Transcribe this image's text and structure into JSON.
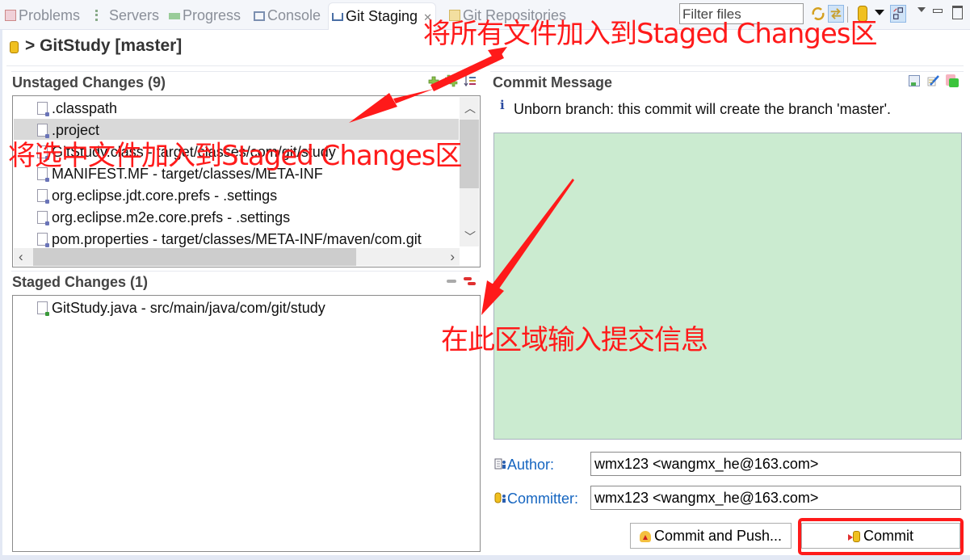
{
  "tabs": [
    {
      "label": "Problems",
      "icon": "problems-icon",
      "active": false
    },
    {
      "label": "Servers",
      "icon": "servers-icon",
      "active": false
    },
    {
      "label": "Progress",
      "icon": "progress-icon",
      "active": false
    },
    {
      "label": "Console",
      "icon": "console-icon",
      "active": false
    },
    {
      "label": "Git Staging",
      "icon": "git-staging-icon",
      "active": true,
      "close_icon": "close-icon"
    },
    {
      "label": "Git Repositories",
      "icon": "git-repositories-icon",
      "active": false
    }
  ],
  "toolbar": {
    "filter_placeholder": "Filter files",
    "icons": [
      "refresh-icon",
      "link-with-selection-icon",
      "repository-icon",
      "dropdown-arrow-icon",
      "presentation-mode-icon",
      "view-menu-icon",
      "minimize-icon",
      "maximize-icon"
    ]
  },
  "repo": {
    "title": "> GitStudy [master]"
  },
  "unstaged": {
    "title": "Unstaged Changes (9)",
    "actions": [
      "add-to-index-icon",
      "add-all-to-index-icon",
      "sort-icon"
    ],
    "items": [
      {
        "label": ".classpath",
        "selected": false
      },
      {
        "label": ".project",
        "selected": true
      },
      {
        "label": "GitStudy.class - target/classes/com/git/study",
        "selected": false
      },
      {
        "label": "MANIFEST.MF - target/classes/META-INF",
        "selected": false
      },
      {
        "label": "org.eclipse.jdt.core.prefs - .settings",
        "selected": false
      },
      {
        "label": "org.eclipse.m2e.core.prefs - .settings",
        "selected": false
      },
      {
        "label": "pom.properties - target/classes/META-INF/maven/com.git",
        "selected": false
      }
    ]
  },
  "staged": {
    "title": "Staged Changes (1)",
    "actions": [
      "collapse-icon",
      "remove-from-index-icon"
    ],
    "items": [
      {
        "label": "GitStudy.java - src/main/java/com/git/study"
      }
    ]
  },
  "commit": {
    "title": "Commit Message",
    "actions": [
      "spell-check-icon",
      "add-signed-off-by-icon",
      "compare-icon"
    ],
    "info": "Unborn branch: this commit will create the branch 'master'.",
    "message": "",
    "message_bg": "#cbebd0",
    "author_label": "Author:",
    "author_value": "wmx123 <wangmx_he@163.com>",
    "committer_label": "Committer:",
    "committer_value": "wmx123 <wangmx_he@163.com>",
    "commit_push_label": "Commit and Push...",
    "commit_label": "Commit"
  },
  "annotations": {
    "stage_all": "将所有文件加入到Staged Changes区",
    "stage_selected": "将选中文件加入到Staged Changes区",
    "enter_message": "在此区域输入提交信息",
    "color": "#ff1a1a"
  }
}
